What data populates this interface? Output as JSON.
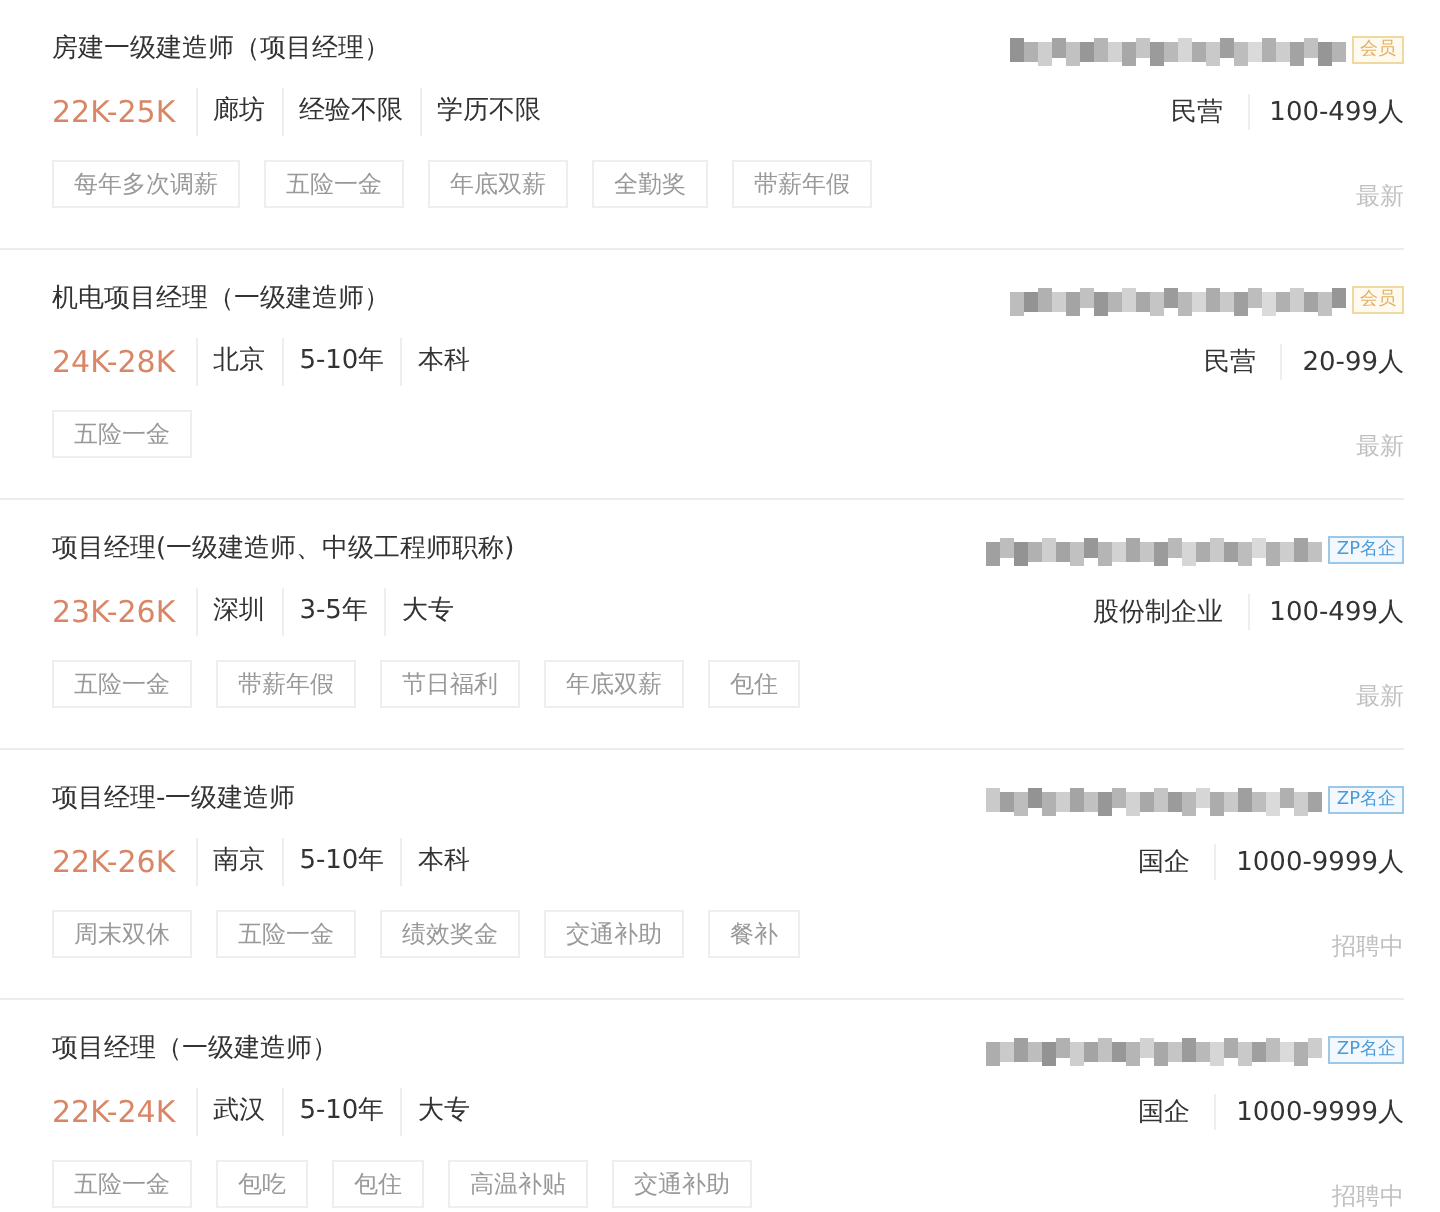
{
  "jobs": [
    {
      "title": "房建一级建造师（项目经理）",
      "salary": "22K-25K",
      "meta": [
        "廊坊",
        "经验不限",
        "学历不限"
      ],
      "badge": {
        "kind": "member",
        "text": "会员"
      },
      "company_type": "民营",
      "company_size": "100-499人",
      "tags": [
        "每年多次调薪",
        "五险一金",
        "年底双薪",
        "全勤奖",
        "带薪年假"
      ],
      "status": "最新"
    },
    {
      "title": "机电项目经理（一级建造师）",
      "salary": "24K-28K",
      "meta": [
        "北京",
        "5-10年",
        "本科"
      ],
      "badge": {
        "kind": "member",
        "text": "会员"
      },
      "company_type": "民营",
      "company_size": "20-99人",
      "tags": [
        "五险一金"
      ],
      "status": "最新"
    },
    {
      "title": "项目经理(一级建造师、中级工程师职称)",
      "salary": "23K-26K",
      "meta": [
        "深圳",
        "3-5年",
        "大专"
      ],
      "badge": {
        "kind": "famous",
        "text": "ZP名企"
      },
      "company_type": "股份制企业",
      "company_size": "100-499人",
      "tags": [
        "五险一金",
        "带薪年假",
        "节日福利",
        "年底双薪",
        "包住"
      ],
      "status": "最新"
    },
    {
      "title": "项目经理-一级建造师",
      "salary": "22K-26K",
      "meta": [
        "南京",
        "5-10年",
        "本科"
      ],
      "badge": {
        "kind": "famous",
        "text": "ZP名企"
      },
      "company_type": "国企",
      "company_size": "1000-9999人",
      "tags": [
        "周末双休",
        "五险一金",
        "绩效奖金",
        "交通补助",
        "餐补"
      ],
      "status": "招聘中"
    },
    {
      "title": "项目经理（一级建造师）",
      "salary": "22K-24K",
      "meta": [
        "武汉",
        "5-10年",
        "大专"
      ],
      "badge": {
        "kind": "famous",
        "text": "ZP名企"
      },
      "company_type": "国企",
      "company_size": "1000-9999人",
      "tags": [
        "五险一金",
        "包吃",
        "包住",
        "高温补贴",
        "交通补助"
      ],
      "status": "招聘中"
    }
  ]
}
